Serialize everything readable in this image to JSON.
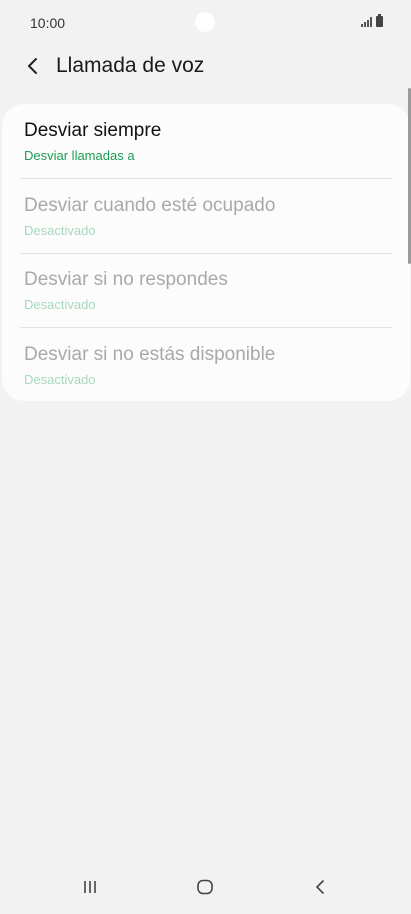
{
  "status_bar": {
    "time": "10:00",
    "signal_icon": "signal-icon",
    "battery_icon": "battery-icon"
  },
  "header": {
    "back_icon": "chevron-left-icon",
    "title": "Llamada de voz"
  },
  "options": [
    {
      "title": "Desviar siempre",
      "subtitle": "Desviar llamadas a",
      "enabled": true
    },
    {
      "title": "Desviar cuando esté ocupado",
      "subtitle": "Desactivado",
      "enabled": false
    },
    {
      "title": "Desviar si no respondes",
      "subtitle": "Desactivado",
      "enabled": false
    },
    {
      "title": "Desviar si no estás disponible",
      "subtitle": "Desactivado",
      "enabled": false
    }
  ],
  "nav_bar": {
    "recents_icon": "recents-icon",
    "home_icon": "home-icon",
    "back_icon": "back-icon"
  },
  "colors": {
    "accent": "#1c9b55",
    "disabled_text": "#a9a9a9",
    "disabled_accent": "#a7d9be",
    "background": "#f2f2f2",
    "card": "#fcfcfc"
  }
}
